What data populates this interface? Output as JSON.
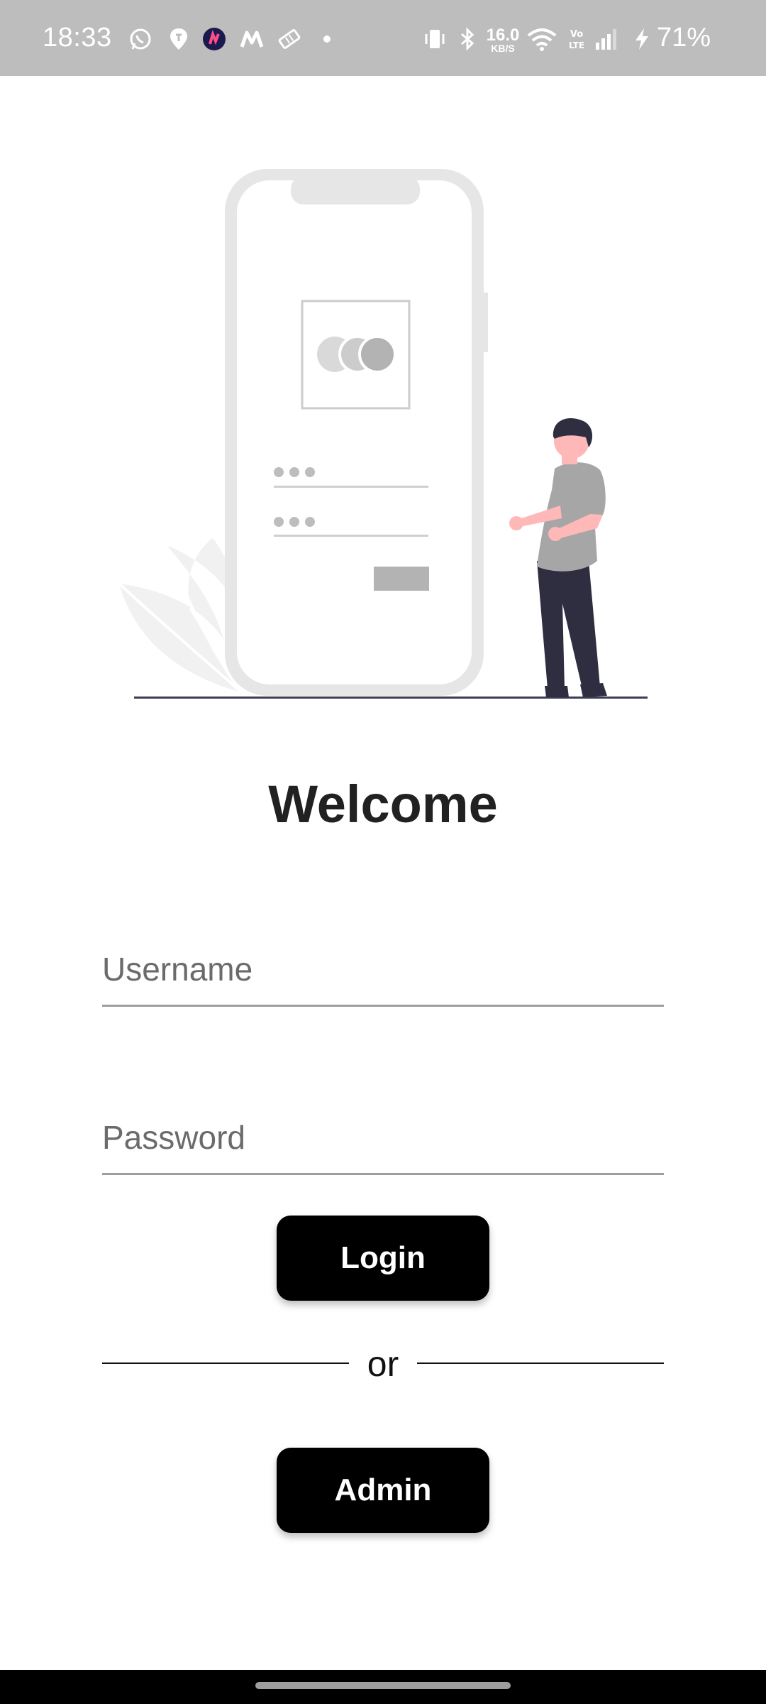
{
  "status_bar": {
    "time": "18:33",
    "notification_icons": [
      "whatsapp-icon",
      "location-pin-icon",
      "app-badge-icon",
      "gmail-m-icon",
      "ticket-icon",
      "dot-icon"
    ],
    "system_icons": [
      "vibrate-icon",
      "bluetooth-icon",
      "wifi-icon",
      "volte-icon",
      "signal-icon",
      "charging-icon"
    ],
    "network_speed": "16.0",
    "network_speed_unit": "KB/S",
    "volte_label": "Vo LTE",
    "battery": "71%"
  },
  "illustration": {
    "description_icons": [
      "phone-mockup",
      "person-figure",
      "leaf-decoration"
    ]
  },
  "welcome_title": "Welcome",
  "form": {
    "username_placeholder": "Username",
    "password_placeholder": "Password",
    "login_label": "Login",
    "or_label": "or",
    "admin_label": "Admin"
  },
  "colors": {
    "status_bar": "#bdbdbd",
    "button_bg": "#000000",
    "button_text": "#ffffff",
    "title": "#212121",
    "input_underline": "#9e9e9e"
  }
}
